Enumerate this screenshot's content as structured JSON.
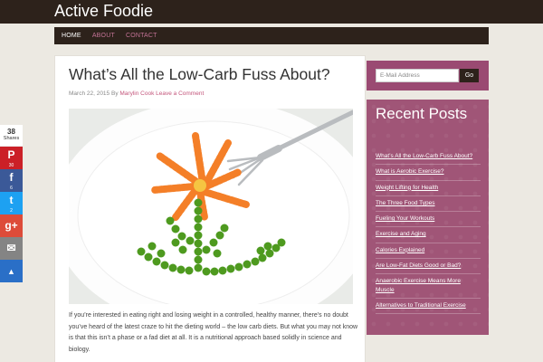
{
  "site": {
    "title": "Active Foodie"
  },
  "nav": {
    "items": [
      {
        "label": "Home"
      },
      {
        "label": "About"
      },
      {
        "label": "Contact"
      }
    ]
  },
  "post": {
    "title": "What’s All the Low-Carb Fuss About?",
    "date": "March 22, 2015",
    "by": "By",
    "author": "Marylin Cook",
    "comment_link": "Leave a Comment",
    "excerpt": "If you’re interested in eating right and losing weight in a controlled, healthy manner, there’s no doubt you’ve heard of the latest craze to hit the dieting world – the low carb diets. But what you may not know is that this isn’t a phase or a fad diet at all. It is a nutritional approach based solidly in science and biology."
  },
  "share": {
    "total": "38",
    "total_label": "Shares",
    "buttons": [
      {
        "network": "pinterest",
        "glyph": "P",
        "count": "30"
      },
      {
        "network": "facebook",
        "glyph": "f",
        "count": "6"
      },
      {
        "network": "twitter",
        "glyph": "t",
        "count": "2"
      },
      {
        "network": "google-plus",
        "glyph": "g+",
        "count": ""
      },
      {
        "network": "email",
        "glyph": "✉",
        "count": ""
      },
      {
        "network": "sumome",
        "glyph": "▲",
        "count": ""
      }
    ]
  },
  "subscribe": {
    "placeholder": "E-Mail Address",
    "button": "Go"
  },
  "recent_posts": {
    "title": "Recent Posts",
    "items": [
      "What’s All the Low-Carb Fuss About?",
      "What is Aerobic Exercise?",
      "Weight Lifting for Health",
      "The Three Food Types",
      "Fueling Your Workouts",
      "Exercise and Aging",
      "Calories Explained",
      "Are Low-Fat Diets Good or Bad?",
      "Anaerobic Exercise Means More Muscle",
      "Alternatives to Traditional Exercise"
    ]
  },
  "colors": {
    "header_bg": "#2d221b",
    "accent": "#c3557b",
    "sidebar_bg": "#a05577",
    "page_bg": "#ece9e2"
  }
}
